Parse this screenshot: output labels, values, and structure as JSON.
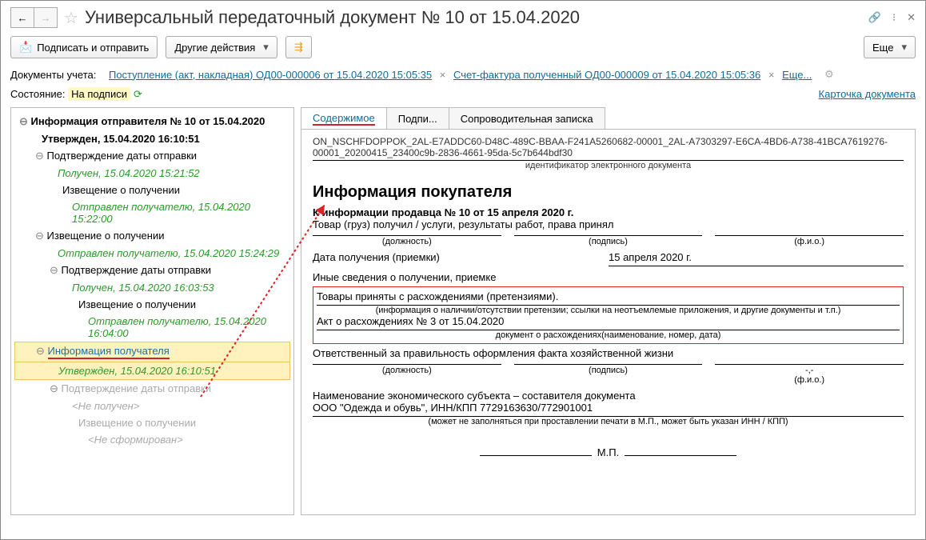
{
  "title": "Универсальный передаточный документ № 10 от 15.04.2020",
  "toolbar": {
    "sign_send": "Подписать и отправить",
    "other": "Другие действия",
    "more": "Еще"
  },
  "docs_label": "Документы учета:",
  "doc_links": {
    "a": "Поступление (акт, накладная) ОД00-000006 от 15.04.2020 15:05:35",
    "b": "Счет-фактура полученный ОД00-000009 от 15.04.2020 15:05:36",
    "more": "Еще..."
  },
  "state_label": "Состояние:",
  "state_val": "На подписи",
  "card_link": "Карточка документа",
  "tree": {
    "root": "Информация отправителя № 10 от 15.04.2020",
    "root_st": "Утвержден, 15.04.2020 16:10:51",
    "n1": "Подтверждение даты отправки",
    "n1_st": "Получен, 15.04.2020 15:21:52",
    "n2": "Извещение о получении",
    "n2_st": "Отправлен получателю, 15.04.2020 15:22:00",
    "n3": "Извещение о получении",
    "n3_st": "Отправлен получателю, 15.04.2020 15:24:29",
    "n4": "Подтверждение даты отправки",
    "n4_st": "Получен, 15.04.2020 16:03:53",
    "n5": "Извещение о получении",
    "n5_st": "Отправлен получателю, 15.04.2020 16:04:00",
    "sel": "Информация получателя",
    "sel_st": "Утвержден, 15.04.2020 16:10:51",
    "n6": "Подтверждение даты отправки",
    "n6_st": "<Не получен>",
    "n7": "Извещение о получении",
    "n7_st": "<Не сформирован>"
  },
  "tabs": {
    "t1": "Содержимое",
    "t2": "Подпи...",
    "t3": "Сопроводительная записка"
  },
  "c": {
    "id": "ON_NSCHFDOPPOK_2AL-E7ADDC60-D48C-489C-BBAA-F241A5260682-00001_2AL-A7303297-E6CA-4BD6-A738-41BCA7619276-00001_20200415_23400c9b-2836-4661-95da-5c7b644bdf30",
    "id_cap": "идентификатор электронного документа",
    "h": "Информация покупателя",
    "ref": "К информации продавца № 10 от 15 апреля 2020 г.",
    "received": "Товар (груз) получил / услуги, результаты работ, права принял",
    "s_pos": "(должность)",
    "s_sig": "(подпись)",
    "s_fio": "(ф.и.о.)",
    "date_l": "Дата получения (приемки)",
    "date_v": "15 апреля 2020 г.",
    "other": "Иные сведения о получении, приемке",
    "claim": "Товары приняты с расхождениями (претензиями).",
    "claim_cap": "(информация о наличии/отсутствии претензии; ссылки на неотъемлемые приложения, и другие  документы и т.п.)",
    "act": "Акт о расхождениях № 3 от 15.04.2020",
    "act_cap": "документ о расхождениях(наименование, номер, дата)",
    "resp": "Ответственный за правильность оформления факта хозяйственной жизни",
    "dash": "-,-",
    "ent": "Наименование экономического субъекта – составителя документа",
    "ent_v": "ООО \"Одежда и обувь\", ИНН/КПП 7729163630/772901001",
    "ent_cap": "(может не заполняться при проставлении печати в М.П., может быть указан ИНН / КПП)",
    "mp": "М.П."
  }
}
